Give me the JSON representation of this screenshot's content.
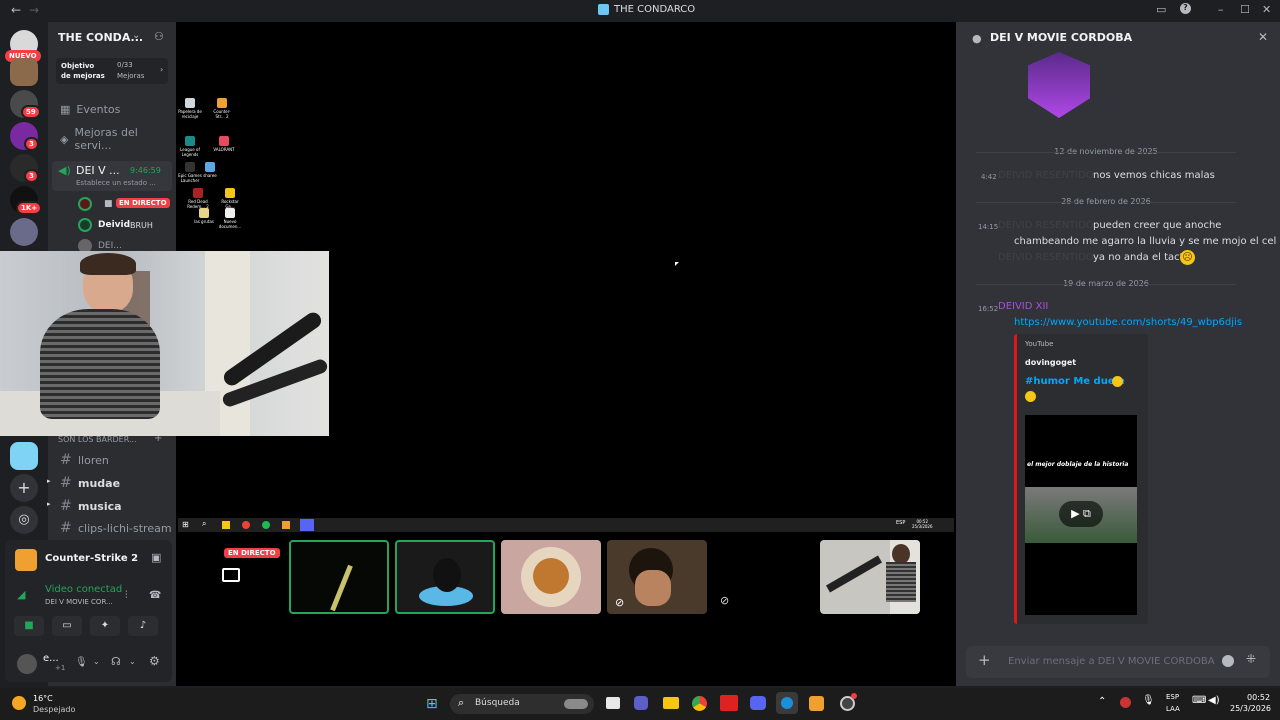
{
  "window": {
    "title": "THE CONDARCO",
    "nav_back": "←",
    "nav_fwd": "→"
  },
  "rail": {
    "new_badge": "NUEVO",
    "badges": [
      "59",
      "3",
      "3",
      "1K+"
    ]
  },
  "sidebar": {
    "guild_name": "THE CONDA...",
    "goal_label": "Objetivo de mejoras",
    "goal_count": "0/33",
    "goal_unit": "Mejoras",
    "events": "Eventos",
    "boosts": "Mejoras del servi...",
    "voice_channel": "DEI V ...",
    "voice_timer": "9:46:59",
    "voice_status": "Establece un estado ...",
    "live_badge": "EN DIRECTO",
    "member1_name": "Deivid",
    "member1_tag": "BRUH",
    "member2_name": "DEI...",
    "category": "SON LOS BARDER...",
    "channels": [
      {
        "name": "lloren",
        "bright": false,
        "arrow": false
      },
      {
        "name": "mudae",
        "bright": true,
        "arrow": true
      },
      {
        "name": "musica",
        "bright": true,
        "arrow": true
      },
      {
        "name": "clips-lichi-stream",
        "bright": false,
        "arrow": false
      }
    ],
    "activity_game": "Counter-Strike 2",
    "voice_connected": "Video conectad",
    "voice_location": "DEI V MOVIE COR...",
    "user_name": "e...",
    "user_sub": "+1"
  },
  "desktop_icons": [
    {
      "label": "Papelera de reciclaje",
      "color": "#cfd8dc"
    },
    {
      "label": "Counter-Str... 2",
      "color": "#f0a030"
    },
    {
      "label": "League of Legends",
      "color": "#1c8a8a"
    },
    {
      "label": "VALORANT",
      "color": "#e84a5f"
    },
    {
      "label": "Epic Games Launcher",
      "color": "#333333"
    },
    {
      "label": "sharee",
      "color": "#5aa9e6"
    },
    {
      "label": "Red Dead Redem... 2",
      "color": "#aa2222"
    },
    {
      "label": "Rockstar Ga...",
      "color": "#f5c518"
    },
    {
      "label": "las grutas",
      "color": "#e8d48a"
    },
    {
      "label": "Nuevo documen...",
      "color": "#eeeeee"
    }
  ],
  "stage": {
    "live_badge": "EN DIRECTO",
    "inner_time": "00:52",
    "inner_date": "25/3/2026",
    "inner_lang": "ESP"
  },
  "panel": {
    "title": "DEI V MOVIE CORDOBA",
    "date1": "12 de noviembre de 2025",
    "msg1_time": "4:42",
    "msg1_author": "DEIVID RESENTIDO",
    "msg1_text": "nos vemos chicas malas",
    "date2": "28 de febrero de 2026",
    "msg2_time": "14:15",
    "msg2_author": "DEIVID RESENTIDO",
    "msg2_line1": "pueden creer que anoche",
    "msg2_line2": "chambeando me agarro la lluvia y se me mojo el cel",
    "msg2_author2": "DEIVID RESENTIDO",
    "msg2_line3": "ya no anda el tactil",
    "date3": "19 de marzo de 2026",
    "msg3_time": "16:52",
    "msg3_author": "DEIVID XII",
    "msg3_link": "https://www.youtube.com/shorts/49_wbp6djis",
    "embed_provider": "YouTube",
    "embed_author": "dovingoget",
    "embed_title": "#humor Me duele",
    "embed_caption": "el mejor doblaje de la historia",
    "input_placeholder": "Enviar mensaje a DEI V MOVIE CORDOBA",
    "accent_link": "#00a8fc",
    "author_color": "#c27c0e"
  },
  "os_taskbar": {
    "weather_temp": "16°C",
    "weather_desc": "Despejado",
    "search": "Búsqueda",
    "lang_top": "ESP",
    "lang_bottom": "LAA",
    "time": "00:52",
    "date": "25/3/2026"
  }
}
